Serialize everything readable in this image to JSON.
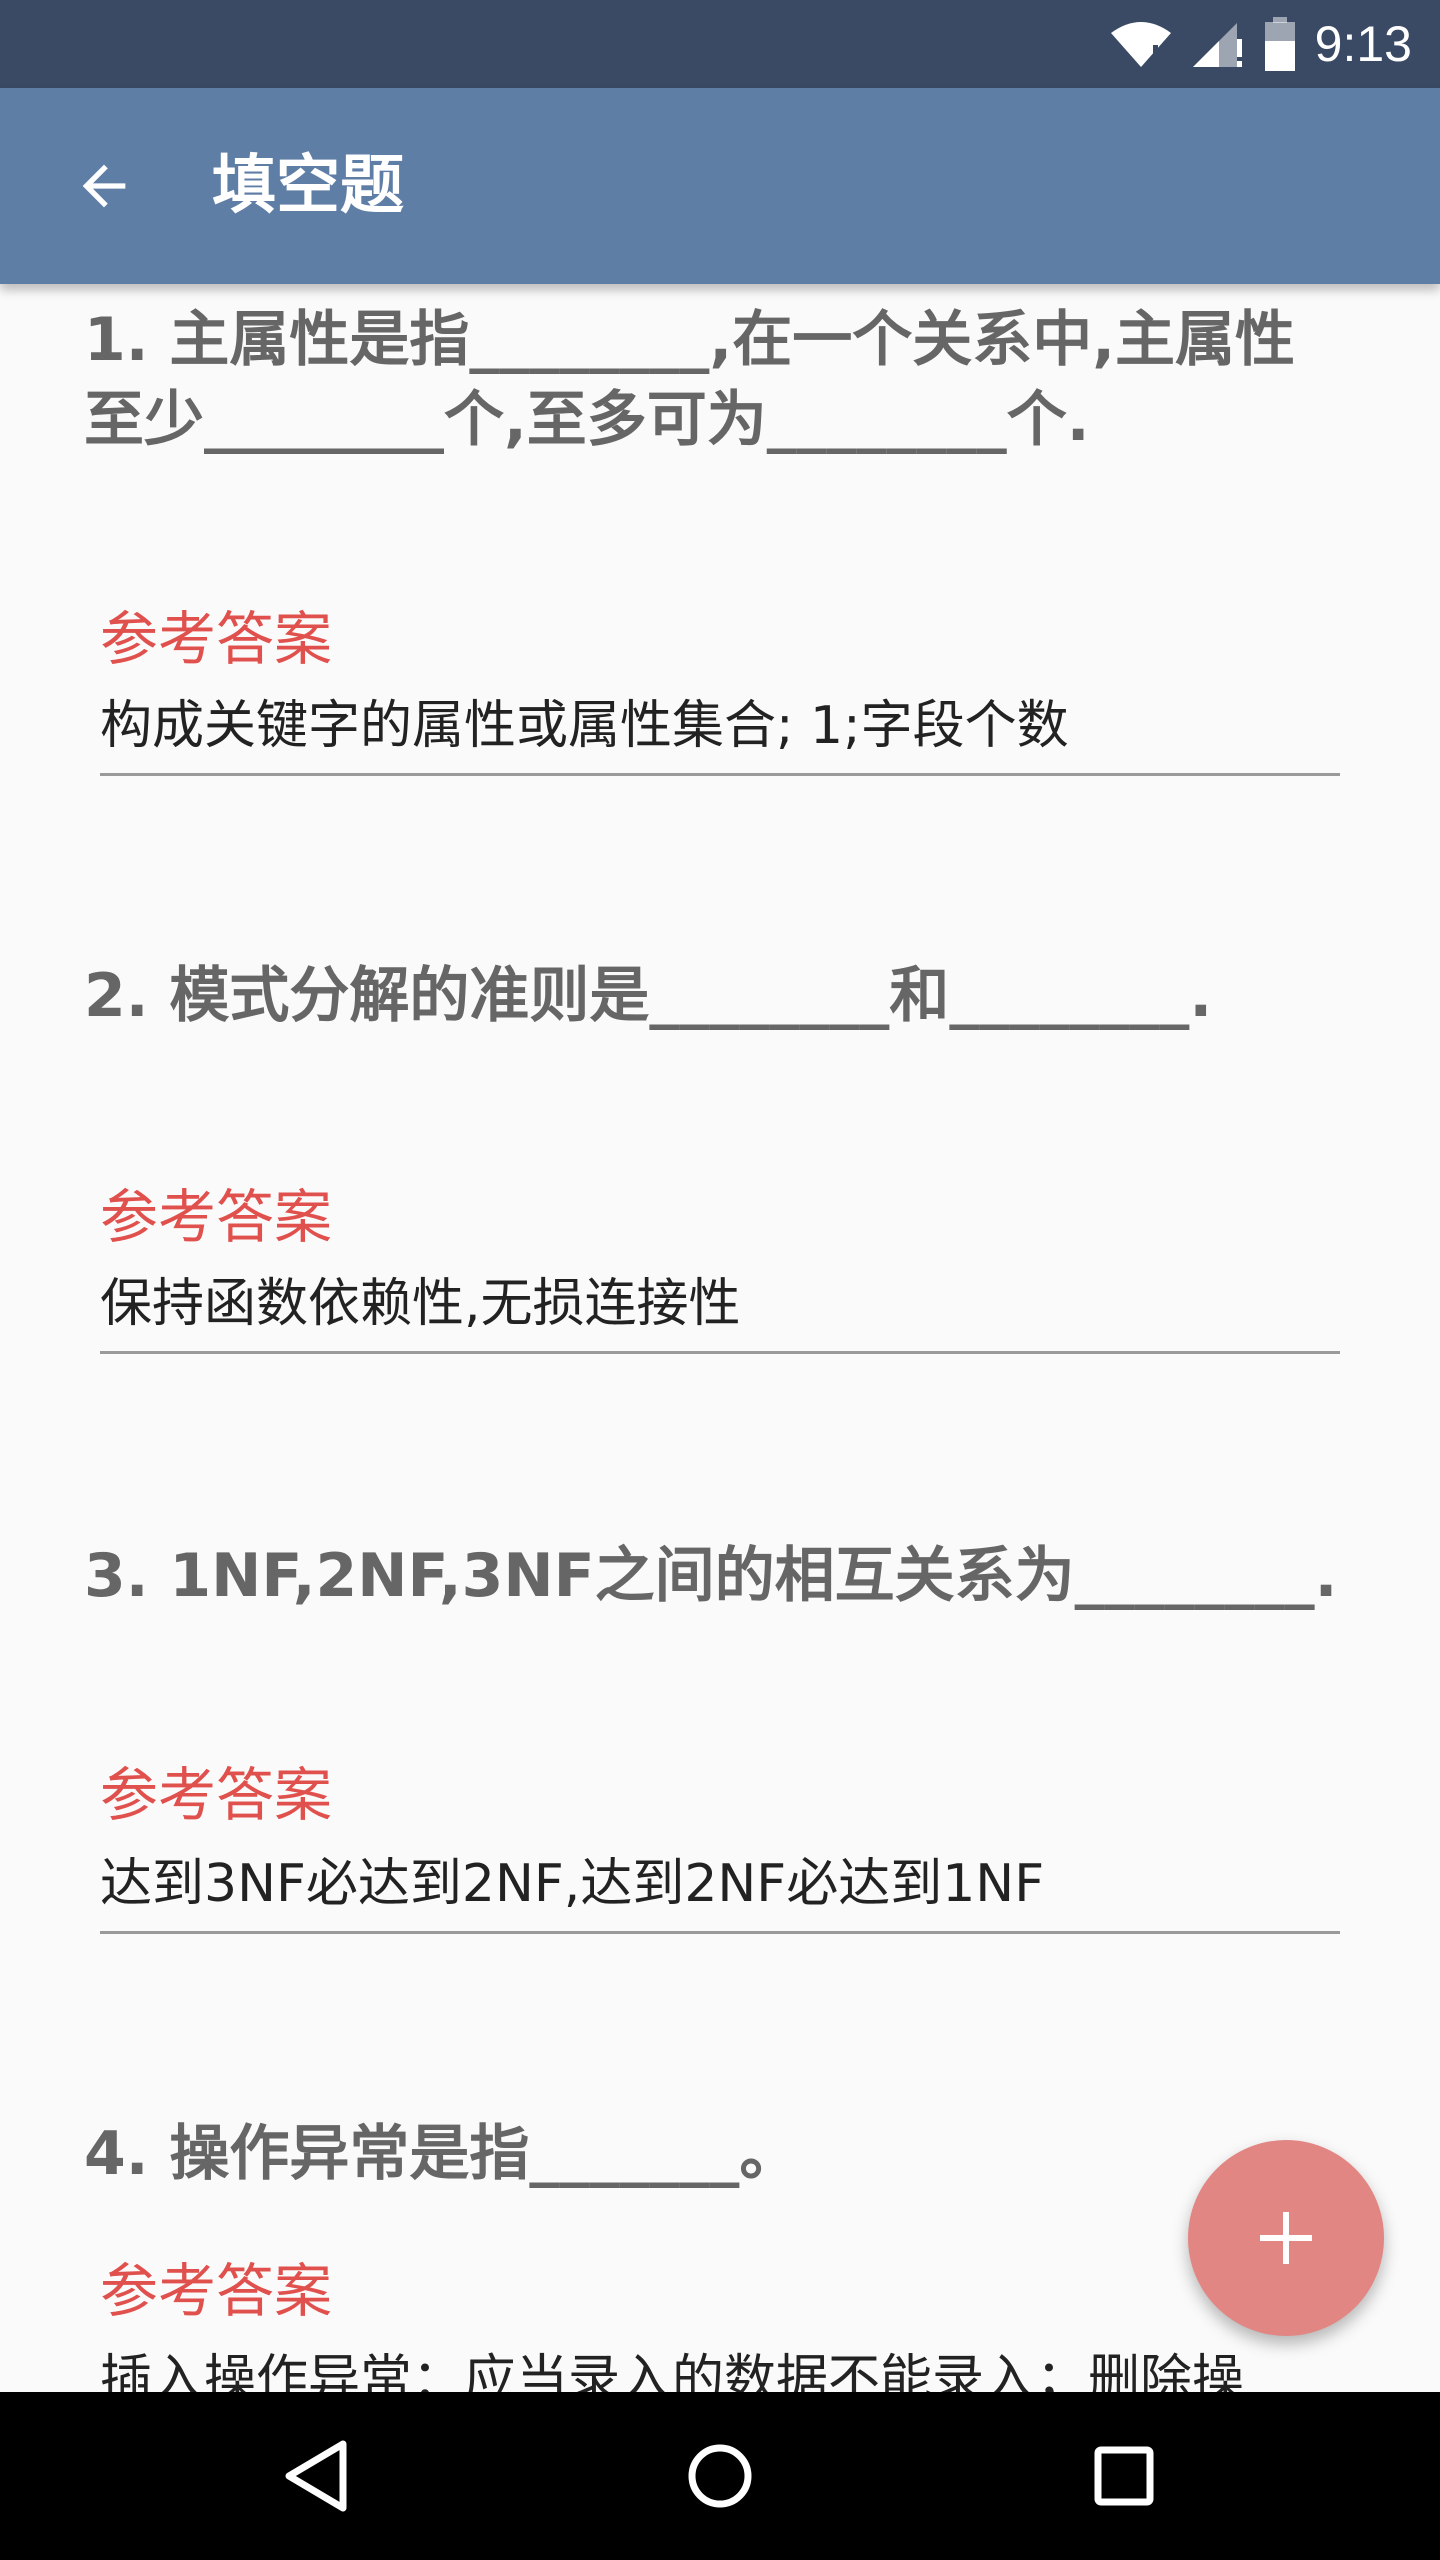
{
  "status_bar": {
    "time": "9:13"
  },
  "app_bar": {
    "title": "填空题",
    "back_icon": "arrow-back-icon"
  },
  "questions": [
    {
      "text": "1. 主属性是指________,在一个关系中,主属性至少________个,至多可为________个.",
      "answer_label": "参考答案",
      "answer": "构成关键字的属性或属性集合; 1;字段个数"
    },
    {
      "text": "2. 模式分解的准则是________和________.",
      "answer_label": "参考答案",
      "answer": "保持函数依赖性,无损连接性"
    },
    {
      "text": "3. 1NF,2NF,3NF之间的相互关系为________.",
      "answer_label": "参考答案",
      "answer": "达到3NF必达到2NF,达到2NF必达到1NF"
    },
    {
      "text": "4. 操作异常是指_______。",
      "answer_label": "参考答案",
      "answer": "插入操作异常：应当录入的数据不能录入；删除操"
    }
  ],
  "fab": {
    "icon": "plus-icon"
  },
  "nav": {
    "back": "nav-back-icon",
    "home": "nav-home-icon",
    "recents": "nav-recents-icon"
  },
  "colors": {
    "status_bar": "#3a4a64",
    "app_bar": "#5f7ea6",
    "accent": "#e0504d",
    "fab": "#e28683"
  }
}
